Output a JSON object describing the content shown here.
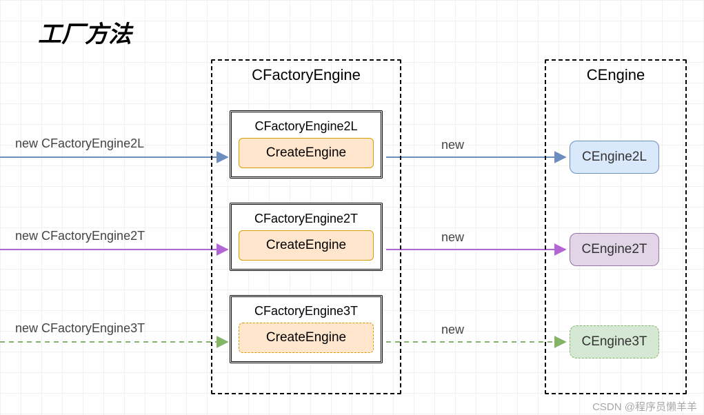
{
  "title": "工厂方法",
  "factoryContainer": {
    "header": "CFactoryEngine"
  },
  "engineContainer": {
    "header": "CEngine"
  },
  "factories": {
    "f1": {
      "name": "CFactoryEngine2L",
      "method": "CreateEngine"
    },
    "f2": {
      "name": "CFactoryEngine2T",
      "method": "CreateEngine"
    },
    "f3": {
      "name": "CFactoryEngine3T",
      "method": "CreateEngine"
    }
  },
  "engines": {
    "e1": "CEngine2L",
    "e2": "CEngine2T",
    "e3": "CEngine3T"
  },
  "arrows": {
    "left": {
      "a1": "new CFactoryEngine2L",
      "a2": "new CFactoryEngine2T",
      "a3": "new CFactoryEngine3T"
    },
    "mid": {
      "m1": "new",
      "m2": "new",
      "m3": "new"
    }
  },
  "watermark": "CSDN @程序员懒羊羊",
  "colors": {
    "blue": "#6c8ebf",
    "purple": "#b266d6",
    "green": "#82b366"
  }
}
